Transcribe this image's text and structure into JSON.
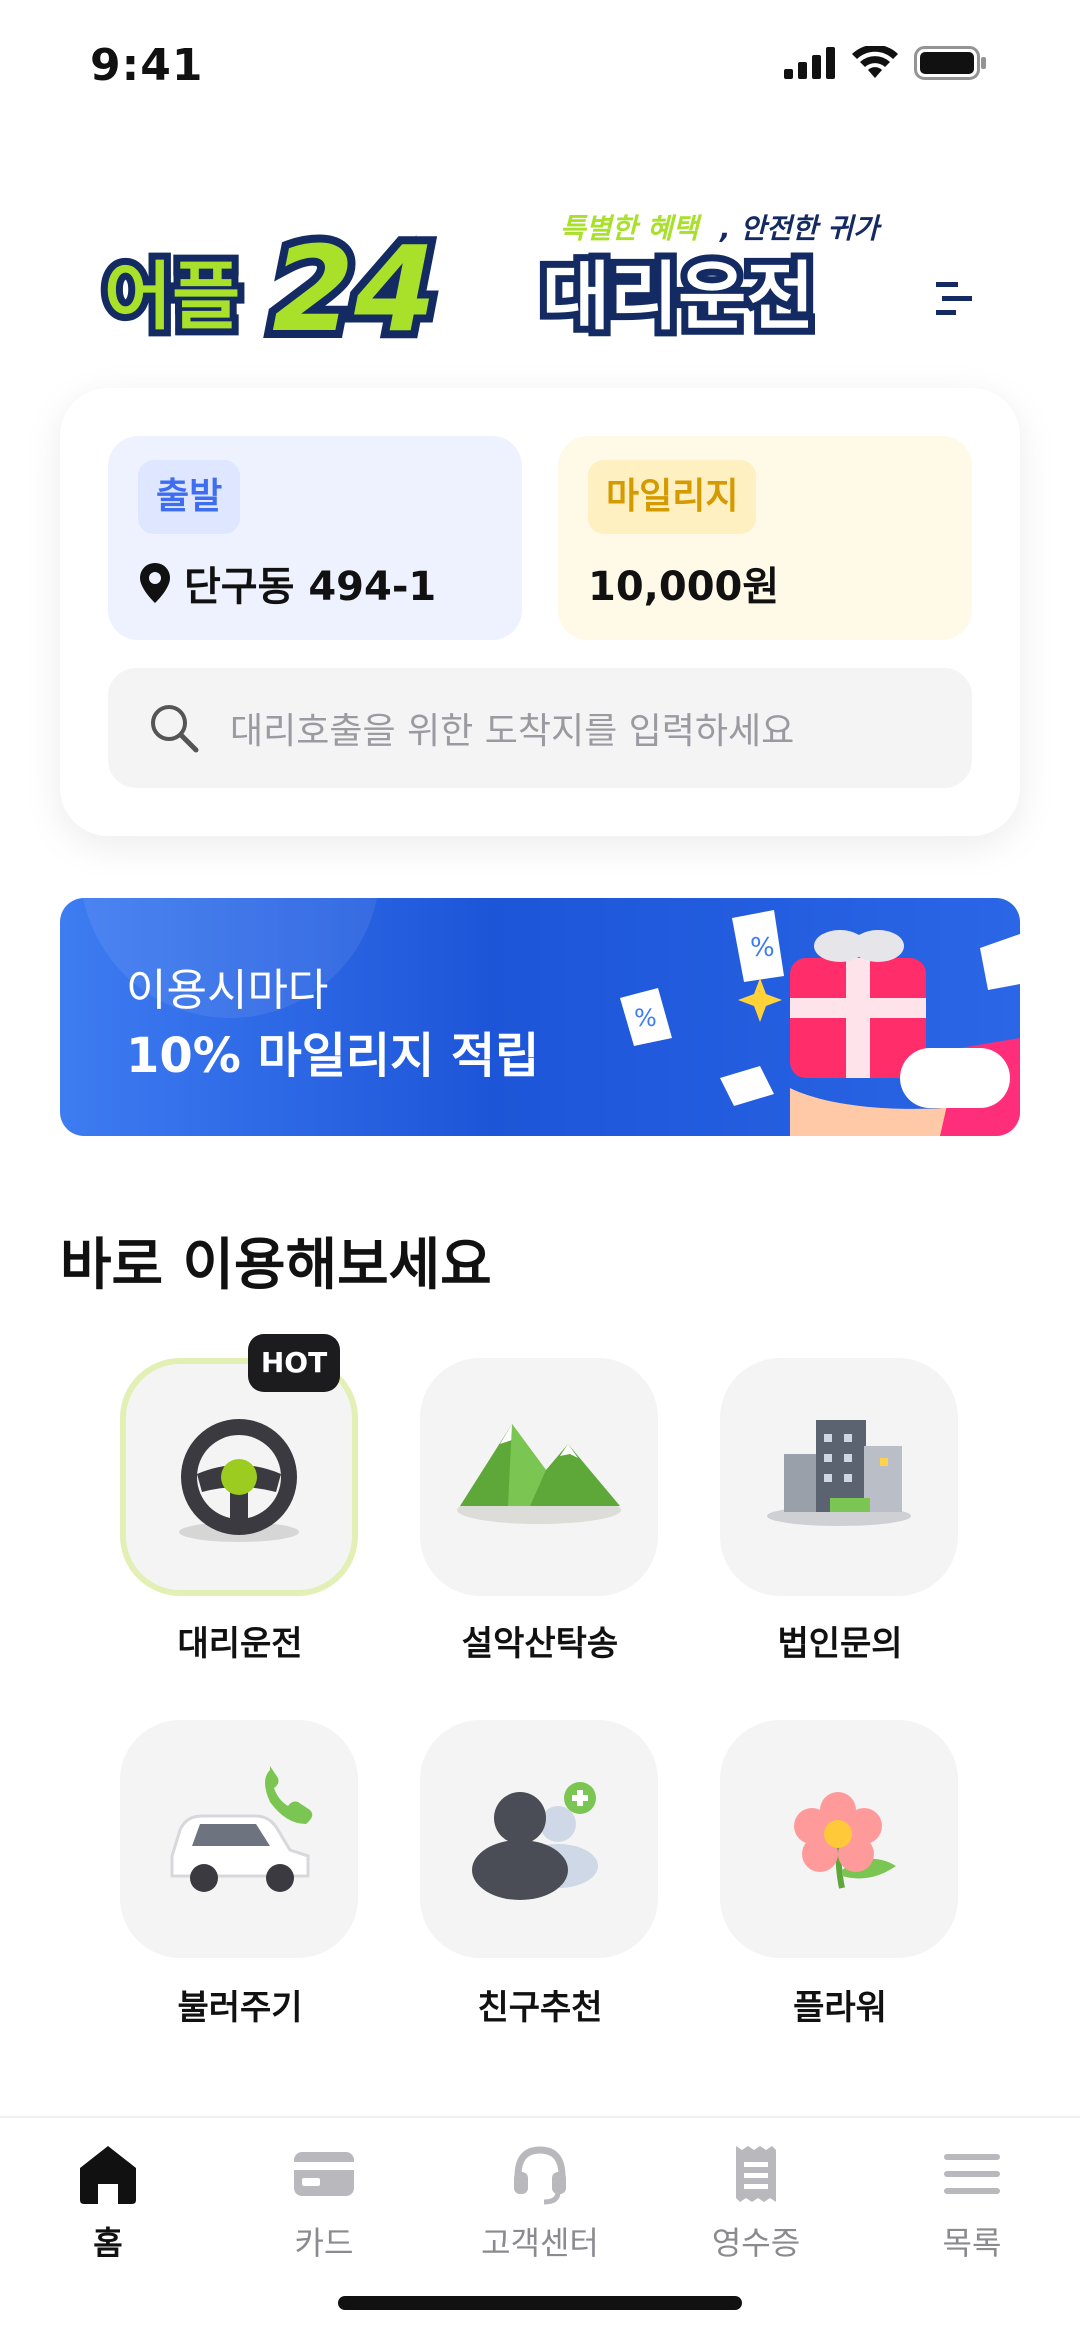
{
  "status": {
    "time": "9:41"
  },
  "logo": {
    "brand": "어플",
    "number": "24",
    "service": "대리운전",
    "tagline_highlight": "특별한 혜택",
    "tagline_rest": ", 안전한 귀가"
  },
  "card": {
    "depart": {
      "label": "출발",
      "address": "단구동 494-1"
    },
    "mileage": {
      "label": "마일리지",
      "amount": "10,000원"
    },
    "search": {
      "placeholder": "대리호출을 위한 도착지를 입력하세요"
    }
  },
  "banner": {
    "line1": "이용시마다",
    "line2": "10% 마일리지 적립"
  },
  "section": {
    "title": "바로 이용해보세요"
  },
  "services": [
    {
      "label": "대리운전",
      "badge": "HOT",
      "icon": "steering-wheel-icon"
    },
    {
      "label": "설악산탁송",
      "icon": "mountain-icon"
    },
    {
      "label": "법인문의",
      "icon": "building-icon"
    },
    {
      "label": "불러주기",
      "icon": "car-phone-icon"
    },
    {
      "label": "친구추천",
      "icon": "add-friend-icon"
    },
    {
      "label": "플라워",
      "icon": "flower-icon"
    }
  ],
  "nav": [
    {
      "label": "홈",
      "icon": "home-icon",
      "active": true
    },
    {
      "label": "카드",
      "icon": "card-icon"
    },
    {
      "label": "고객센터",
      "icon": "headset-icon"
    },
    {
      "label": "영수증",
      "icon": "receipt-icon"
    },
    {
      "label": "목록",
      "icon": "menu-icon"
    }
  ],
  "colors": {
    "accent_blue": "#3f6df0",
    "accent_yellow": "#d49a00",
    "brand_green": "#a8e02a",
    "brand_navy": "#132a63"
  }
}
